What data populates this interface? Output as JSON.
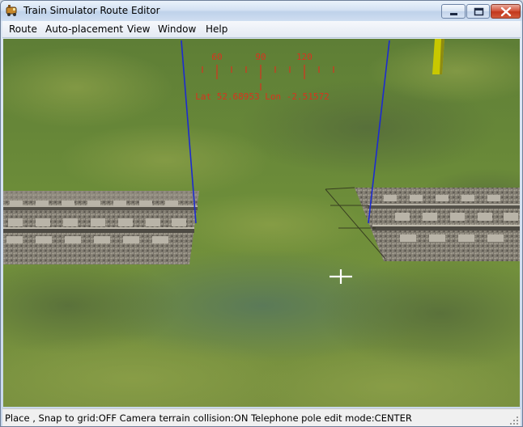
{
  "window": {
    "title": "Train Simulator Route Editor"
  },
  "menu": {
    "route": "Route",
    "auto_placement": "Auto-placement",
    "view": "View",
    "window": "Window",
    "help": "Help"
  },
  "compass": {
    "headings": [
      "60",
      "90",
      "120"
    ],
    "coords": "Lat 52.68953 Lon -2.51572"
  },
  "status": "Place , Snap to grid:OFF Camera terrain collision:ON Telephone pole edit mode:CENTER",
  "colors": {
    "terrain": "#6a8a36",
    "hud": "#d8331e",
    "wire": "#1c2bd0",
    "pole": "#c8c800"
  }
}
